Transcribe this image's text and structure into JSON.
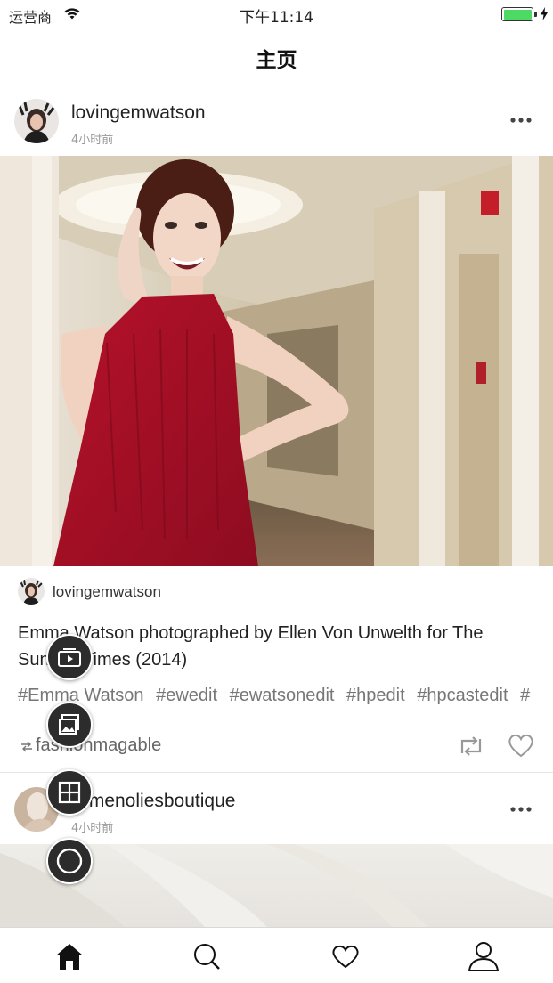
{
  "status_bar": {
    "carrier": "运营商",
    "time": "下午11:14",
    "battery_color": "#4cd964"
  },
  "nav": {
    "title": "主页"
  },
  "post1": {
    "username": "lovingemwatson",
    "time_ago": "4小时前",
    "source_username": "lovingemwatson",
    "caption": "Emma Watson photographed by Ellen Von Unwelth for The Sunday Times (2014)",
    "hashtags": [
      "#Emma Watson",
      "#ewedit",
      "#ewatsonedit",
      "#hpedit",
      "#hpcastedit",
      "#"
    ],
    "reposted_by": "fashionmagable"
  },
  "post2": {
    "username": "silmenoliesboutique",
    "time_ago": "4小时前"
  },
  "fab_menu": {
    "icons": [
      "video-post-icon",
      "photo-post-icon",
      "grid-post-icon",
      "circle-post-icon"
    ]
  },
  "tab_bar": {
    "icons": [
      "home-icon",
      "search-icon",
      "heart-icon",
      "profile-icon"
    ],
    "active": "home-icon"
  }
}
